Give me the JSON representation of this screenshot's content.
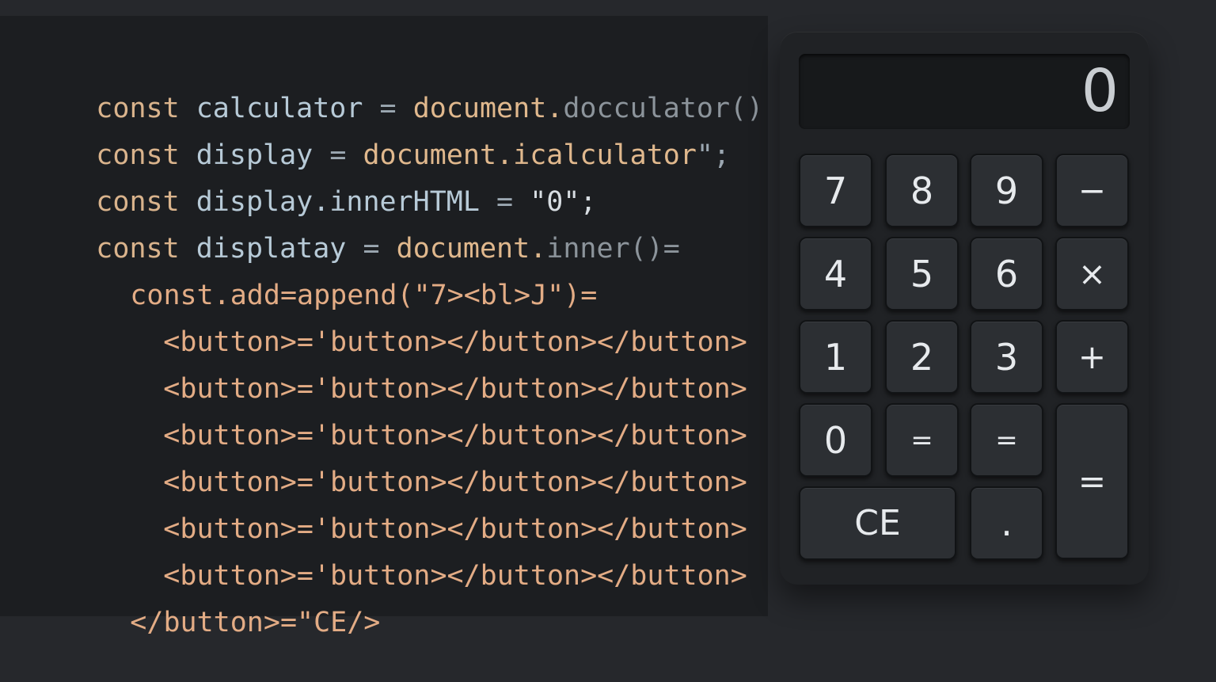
{
  "code": {
    "lines": [
      [
        "const",
        "calculator",
        "=",
        "document.",
        "docculator()"
      ],
      [
        "const",
        "display",
        "=",
        "document.icalculator",
        "\";"
      ],
      [
        "const",
        "display.innerHTML",
        "=",
        "\"0\";"
      ],
      [
        "const",
        "displatay",
        "=",
        "document.",
        "inner()="
      ],
      [
        "const.add=append(\"7><bl>J\")="
      ],
      [
        "<button>='button></button></button>"
      ],
      [
        "<button>='button></button></button>"
      ],
      [
        "<button>='button></button></button>"
      ],
      [
        "<button>='button></button></button>"
      ],
      [
        "<button>='button></button></button>"
      ],
      [
        "<button>='button></button></button>"
      ],
      [
        "</button>=\"CE/>"
      ]
    ]
  },
  "calculator": {
    "display_value": "0",
    "keys": {
      "k7": "7",
      "k8": "8",
      "k9": "9",
      "minus": "−",
      "k4": "4",
      "k5": "5",
      "k6": "6",
      "multiply": "×",
      "k1": "1",
      "k2": "2",
      "k3": "3",
      "plus": "+",
      "k0": "0",
      "eq_a": "=",
      "eq_b": "=",
      "equals": "=",
      "ce": "CE",
      "dot": "."
    }
  }
}
